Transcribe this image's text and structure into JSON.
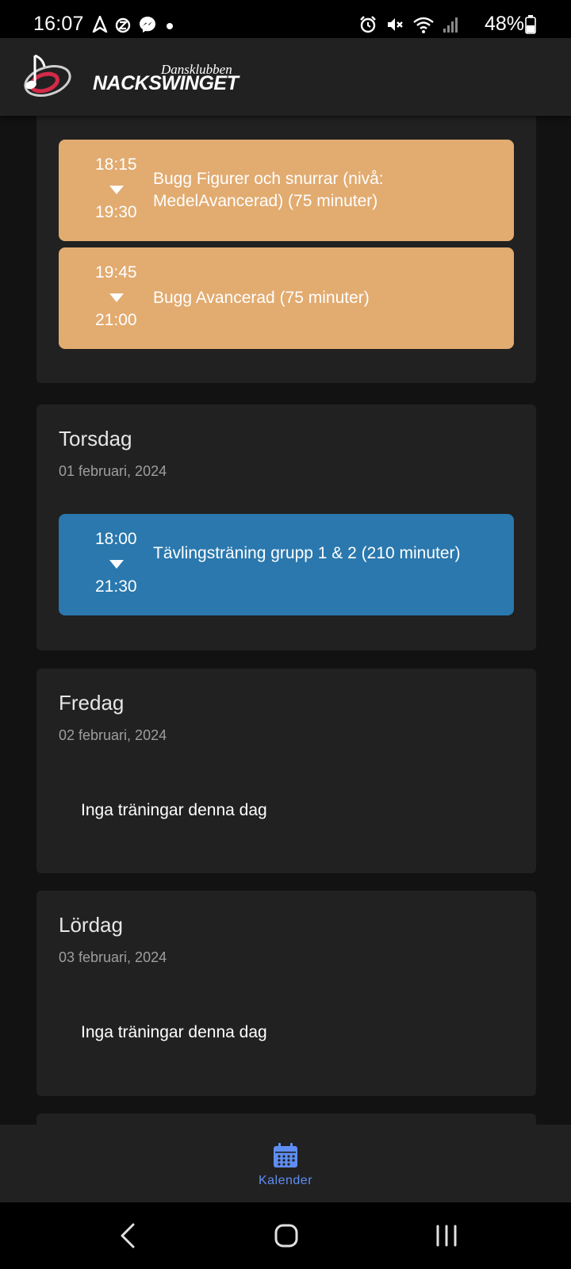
{
  "status_bar": {
    "time": "16:07",
    "battery": "48%",
    "left_icons": [
      "navigation-icon",
      "alarm-z-icon",
      "messenger-icon",
      "dot-icon"
    ],
    "right_icons": [
      "alarm-icon",
      "mute-icon",
      "wifi-icon",
      "signal-icon",
      "battery-icon"
    ]
  },
  "app_bar": {
    "logo_sub": "Dansklubben",
    "logo_main": "NACKSWINGET"
  },
  "days": [
    {
      "events": [
        {
          "start": "18:15",
          "end": "19:30",
          "title": "Bugg Figurer och snurrar (nivå: MedelAvancerad) (75 minuter)",
          "color": "#e2ab70"
        },
        {
          "start": "19:45",
          "end": "21:00",
          "title": "Bugg Avancerad (75 minuter)",
          "color": "#e2ab70"
        }
      ]
    },
    {
      "name": "Torsdag",
      "date": "01 februari, 2024",
      "events": [
        {
          "start": "18:00",
          "end": "21:30",
          "title": "Tävlingsträning grupp 1 & 2 (210 minuter)",
          "color": "#2a78ae"
        }
      ]
    },
    {
      "name": "Fredag",
      "date": "02 februari, 2024",
      "empty": "Inga träningar denna dag"
    },
    {
      "name": "Lördag",
      "date": "03 februari, 2024",
      "empty": "Inga träningar denna dag"
    }
  ],
  "bottom_nav": {
    "label": "Kalender",
    "icon": "calendar-icon",
    "accent": "#5f8ef2"
  },
  "system_nav": [
    "back-icon",
    "home-icon",
    "recents-icon"
  ]
}
